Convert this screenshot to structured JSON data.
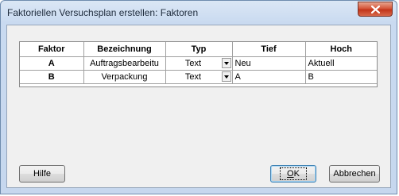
{
  "window": {
    "title": "Faktoriellen Versuchsplan erstellen: Faktoren",
    "close_icon": "close-x-icon"
  },
  "table": {
    "headers": [
      "Faktor",
      "Bezeichnung",
      "Typ",
      "Tief",
      "Hoch"
    ],
    "rows": [
      {
        "factor": "A",
        "name": "Auftragsbearbeitu",
        "type": "Text",
        "low": "Neu",
        "high": "Aktuell"
      },
      {
        "factor": "B",
        "name": "Verpackung",
        "type": "Text",
        "low": "A",
        "high": "B"
      }
    ]
  },
  "buttons": {
    "help": "Hilfe",
    "ok_mnemonic": "O",
    "ok_rest": "K",
    "cancel": "Abbrechen"
  }
}
